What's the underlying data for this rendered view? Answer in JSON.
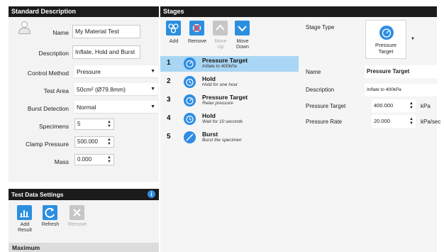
{
  "left_panel": {
    "title": "Standard Description",
    "fields": {
      "name_label": "Name",
      "name_value": "My Material Test",
      "description_label": "Description",
      "description_value": "Inflate, Hold and Burst",
      "control_method_label": "Control Method",
      "control_method_value": "Pressure",
      "test_area_label": "Test Area",
      "test_area_value": "50cm² (Ø79.8mm)",
      "burst_detection_label": "Burst Detection",
      "burst_detection_value": "Normal",
      "specimens_label": "Specimens",
      "specimens_value": "5",
      "clamp_pressure_label": "Clamp Pressure",
      "clamp_pressure_value": "500.000",
      "mass_label": "Mass",
      "mass_value": "0.000"
    }
  },
  "test_data": {
    "title": "Test Data Settings",
    "info_glyph": "i",
    "buttons": {
      "add_result_line1": "Add",
      "add_result_line2": "Result",
      "refresh": "Refresh",
      "remove": "Remove"
    },
    "section_label": "Maximum"
  },
  "stages": {
    "title": "Stages",
    "toolbar": {
      "add": "Add",
      "remove": "Remove",
      "move_up_line1": "Move",
      "move_up_line2": "Up",
      "move_down_line1": "Move",
      "move_down_line2": "Down"
    },
    "items": [
      {
        "num": "1",
        "title": "Pressure Target",
        "sub": "Inflate to 400kPa",
        "icon": "pressure-gauge-icon"
      },
      {
        "num": "2",
        "title": "Hold",
        "sub": "Hold for one hour",
        "icon": "timer-icon"
      },
      {
        "num": "3",
        "title": "Pressure Target",
        "sub": "Relax pressure",
        "icon": "pressure-gauge-icon"
      },
      {
        "num": "4",
        "title": "Hold",
        "sub": "Wait for 10 seconds",
        "icon": "timer-icon"
      },
      {
        "num": "5",
        "title": "Burst",
        "sub": "Burst the specimen",
        "icon": "burst-icon"
      }
    ]
  },
  "stage_props": {
    "stage_type_label": "Stage Type",
    "stage_type_value_line1": "Pressure",
    "stage_type_value_line2": "Target",
    "name_label": "Name",
    "name_value": "Pressure Target",
    "description_label": "Description",
    "description_value": "Inflate to 400kPa",
    "pressure_target_label": "Pressure Target",
    "pressure_target_value": "400.000",
    "pressure_target_unit": "kPa",
    "pressure_rate_label": "Pressure Rate",
    "pressure_rate_value": "20.000",
    "pressure_rate_unit": "kPa/sec"
  },
  "colors": {
    "header_bg": "#1b1b1b",
    "accent_blue": "#2b8fe0",
    "selected_row": "#a9d6f4"
  }
}
